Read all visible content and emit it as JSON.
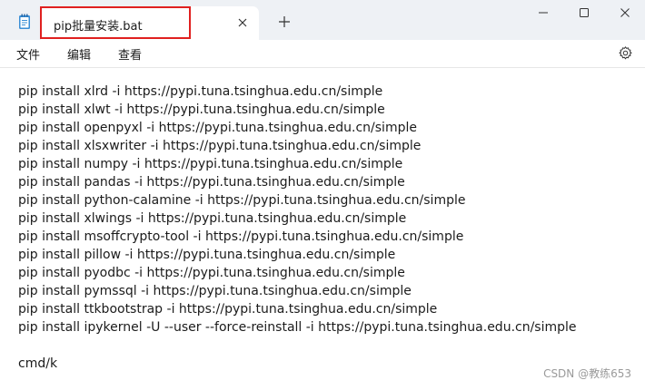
{
  "tab": {
    "title": "pip批量安装.bat"
  },
  "menu": {
    "file": "文件",
    "edit": "编辑",
    "view": "查看"
  },
  "icons": {
    "app": "notepad-icon",
    "tab_close": "close-icon",
    "new_tab": "plus-icon",
    "minimize": "minimize-icon",
    "maximize": "maximize-icon",
    "close": "close-icon",
    "settings": "gear-icon"
  },
  "colors": {
    "highlight": "#e0201f",
    "titlebar": "#eef1f5"
  },
  "editor": {
    "lines": [
      "pip install xlrd -i https://pypi.tuna.tsinghua.edu.cn/simple",
      "pip install xlwt -i https://pypi.tuna.tsinghua.edu.cn/simple",
      "pip install openpyxl -i https://pypi.tuna.tsinghua.edu.cn/simple",
      "pip install xlsxwriter -i https://pypi.tuna.tsinghua.edu.cn/simple",
      "pip install numpy -i https://pypi.tuna.tsinghua.edu.cn/simple",
      "pip install pandas -i https://pypi.tuna.tsinghua.edu.cn/simple",
      "pip install python-calamine -i https://pypi.tuna.tsinghua.edu.cn/simple",
      "pip install xlwings -i https://pypi.tuna.tsinghua.edu.cn/simple",
      "pip install msoffcrypto-tool -i https://pypi.tuna.tsinghua.edu.cn/simple",
      "pip install pillow -i https://pypi.tuna.tsinghua.edu.cn/simple",
      "pip install pyodbc -i https://pypi.tuna.tsinghua.edu.cn/simple",
      "pip install pymssql -i https://pypi.tuna.tsinghua.edu.cn/simple",
      "pip install ttkbootstrap -i https://pypi.tuna.tsinghua.edu.cn/simple",
      "pip install ipykernel -U --user --force-reinstall -i https://pypi.tuna.tsinghua.edu.cn/simple",
      "",
      "cmd/k"
    ]
  },
  "watermark": "CSDN @教练653"
}
